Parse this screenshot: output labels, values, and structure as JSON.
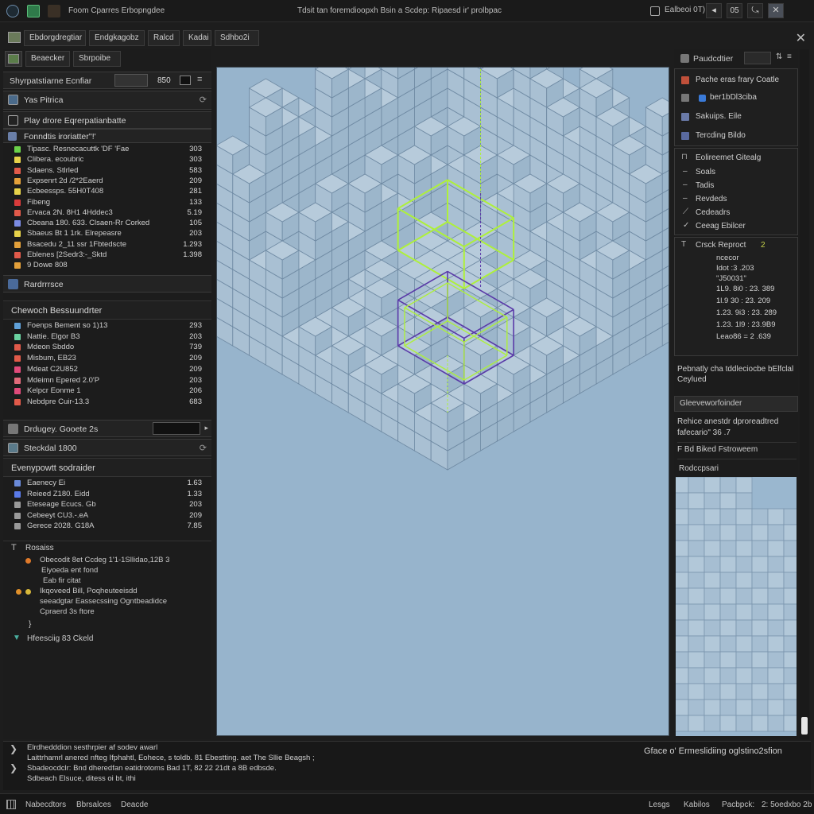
{
  "title_bar": {
    "app_name": "Foom Cparres Erbopngdee",
    "document_title": "Tdsit tan foremdioopxh Bsin a Scdep: Ripaesd ir' prolbpac",
    "status": "Ealbeoi 0T)",
    "zoom_value": "05"
  },
  "tabs": [
    "Ebdorgdregtiar",
    "Endgkagobz",
    "Ralcd",
    "Kadai",
    "Sdhbo2i"
  ],
  "left_panel": {
    "tabs": [
      "Beaecker",
      "Sbrpoibe"
    ],
    "search": {
      "label": "Shyrpatstiarne Ecnfiar",
      "value": "850"
    },
    "item_1": "Yas Pitrica",
    "item_2": "Play drore Eqrerpatianbatte",
    "section_1_title": "Fonndtis iroriatter''!'",
    "rows_1": [
      {
        "text": "Tipasc. Resnecacuttk 'DF 'Fae",
        "value": "303",
        "color": "#6bd24a"
      },
      {
        "text": "Clibera. ecoubric",
        "value": "303",
        "color": "#e7d24a"
      },
      {
        "text": "Sdaens. Stlrled",
        "value": "583",
        "color": "#e15a4a"
      },
      {
        "text": "Expsenrt 2d /2*2Eaerd",
        "value": "209",
        "color": "#e3a03a"
      },
      {
        "text": "Ecbeessps. 55H0T408",
        "value": "281",
        "color": "#e7d24a"
      },
      {
        "text": "Fibeng",
        "value": "133",
        "color": "#d83b3b"
      },
      {
        "text": "Ervaca 2N. 8H1 4Hddec3",
        "value": "5.19",
        "color": "#e15a4a"
      },
      {
        "text": "Cbeana 180. 633. Clsaen-Rr Corked",
        "value": "105",
        "color": "#7b8be3"
      },
      {
        "text": "Sbaeus Bt 1 1rk. Elrepeasre",
        "value": "203",
        "color": "#e7d24a"
      },
      {
        "text": "Bsacedu 2_11 ssr 1Fbtedscte",
        "value": "1.293",
        "color": "#e3a03a"
      },
      {
        "text": "Eblenes [2Sedr3:-_Sktd",
        "value": "1.398",
        "color": "#e15a4a"
      },
      {
        "text": "9 Dowe 808",
        "value": "",
        "color": "#e3a03a"
      }
    ],
    "item_3": "Rardrrrsce",
    "section_2_title": "Chewoch Bessuundrter",
    "rows_2": [
      {
        "text": "Foenps Bement so 1)13",
        "value": "293",
        "color": "#5fa0d8"
      },
      {
        "text": "Nattie. Elgor B3",
        "value": "203",
        "color": "#6ad2a0"
      },
      {
        "text": "Mdeon Sbddo",
        "value": "739",
        "color": "#e15a4a"
      },
      {
        "text": "Misbum, EB23",
        "value": "209",
        "color": "#e15a4a"
      },
      {
        "text": "Mdeat C2U852",
        "value": "209",
        "color": "#e04a7a"
      },
      {
        "text": "Mdeimn Epered 2.0'P",
        "value": "203",
        "color": "#e06a7a"
      },
      {
        "text": "Kelpcr Eonme 1",
        "value": "206",
        "color": "#e04a7a"
      },
      {
        "text": "Nebdpre Cuir-13.3",
        "value": "683",
        "color": "#e15a4a"
      }
    ],
    "item_4": "Drdugey. Gooete 2s",
    "item_5": "Steckdal 1800",
    "section_3_title": "Evenypowtt sodraider",
    "rows_3": [
      {
        "text": "Eaenecy Ei",
        "value": "1.63",
        "color": "#6a8ad8"
      },
      {
        "text": "Reieed Z180. Eidd",
        "value": "1.33",
        "color": "#5a7ae8"
      },
      {
        "text": "Eteseage Ecucs. Gb",
        "value": "203",
        "color": "#9a9a9a"
      },
      {
        "text": "Cebeeyt CU3.-.eA",
        "value": "209",
        "color": "#9a9a9a"
      },
      {
        "text": "Gerece 2028. G18A",
        "value": "7.85",
        "color": "#9a9a9a"
      }
    ],
    "section_4_title": "Rosaiss",
    "notes": [
      "Obecodit 8et Ccdeg 1'1-1Sllidao,12B 3",
      "Eiyoeda ent fond",
      "Eab fir citat",
      "Ikqoveed Bill, Poqheuteeisdd",
      "seeadgtar Eassecssing Ogntbeadidce",
      "Cpraerd 3s ftore",
      "}"
    ],
    "footer_item": "Hfeesciig 83 Ckeld"
  },
  "right_panel": {
    "header": "Paudcdtier",
    "items": [
      "Pache eras frary Coatle",
      "ber1bDl3ciba",
      "Sakuips. Eile",
      "Tercding Bildo"
    ],
    "section_1_title": "Eolireemet Gitealg",
    "section_1_items": [
      "Soals",
      "Tadis",
      "Revdeds",
      "Cedeadrs",
      "Ceeag Ebilcer"
    ],
    "section_2_title": "Crsck Reproct",
    "section_2_badge": "2",
    "section_2_items": [
      "ncecor",
      "Idot :3 .203",
      "\"J50031\"",
      "1L9. 8i0 : 23. 389",
      "1l.9 30 : 23. 209",
      "1.23. 9i3 : 23. 289",
      "1.23. 1l9 : 23.9B9",
      "Leao86 = 2 .639"
    ],
    "note_1": "Pebnatly cha tddleciocbe bElfclal Ceylued",
    "section_3_title": "Gleeveworfoinder",
    "note_2": "Rehice anestdr dproreadtred fafecario\" 36 .7",
    "note_3": "F Bd Biked Fstroweem",
    "preview_title": "Rodccpsari"
  },
  "console": {
    "lines": [
      "Elrdhedddion sesthrpier af sodev awarl",
      "Laittrhamrl anered nfteg Ifphahtl, Eohece, s toldb. 81 Ebestting. aet The Sllie Beagsh ;",
      "Sbadeocdclr: Bnd dheredfan eatidrotoms Bad 1T, 82 22 21dt a 8B edbsde.",
      "Sdbeach Elsuce, ditess oi bt, ithi"
    ],
    "right_text": "Gface o' Ermeslidiing oglstino2sfion"
  },
  "status_bar": {
    "left": [
      "Nabecdtors",
      "Bbrsalces",
      "Deacde"
    ],
    "right": [
      "Lesgs",
      "Kabilos",
      "Pacbpck:",
      "2: 5oedxbo 2b"
    ]
  },
  "colors": {
    "viewport_bg": "#97b4cc",
    "highlight_green": "#aef03a",
    "highlight_purple": "#5a3aa8"
  }
}
